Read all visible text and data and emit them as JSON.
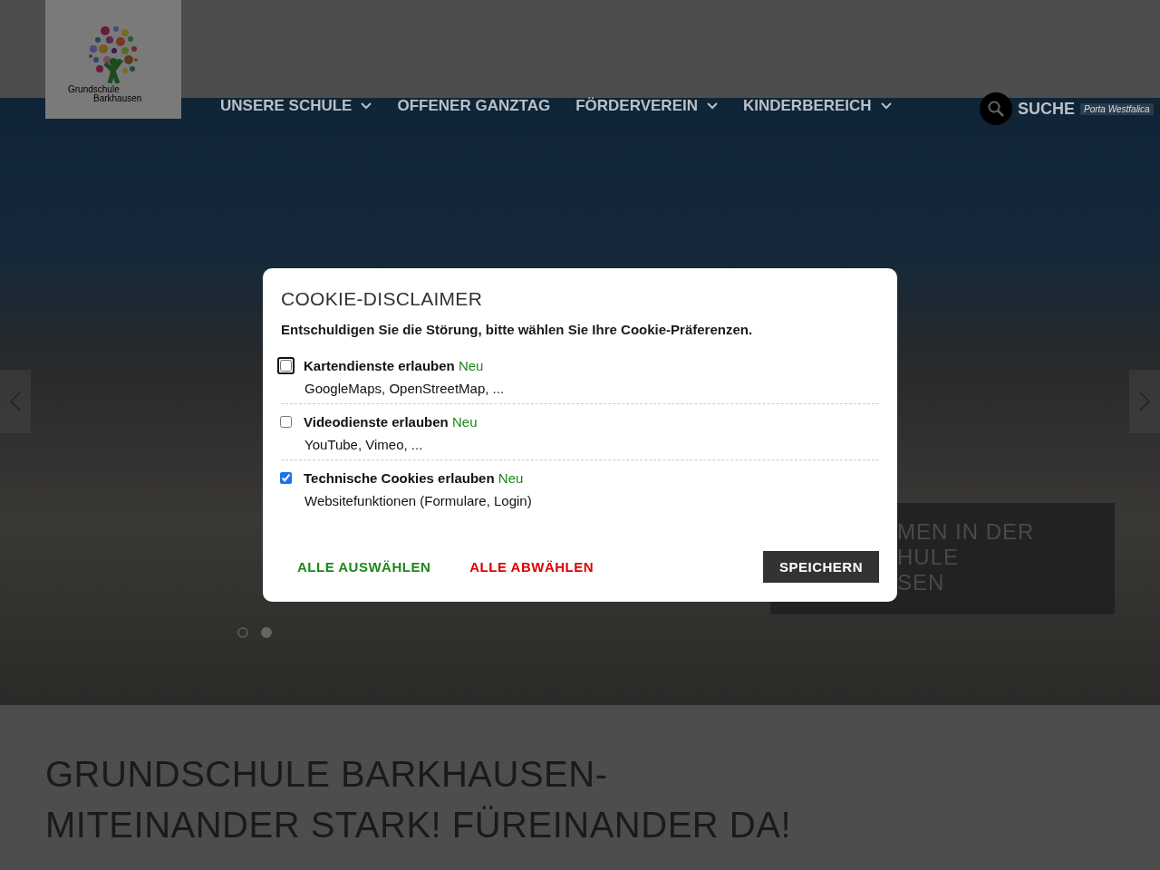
{
  "logo": {
    "lines": [
      "Grundschule",
      "Barkhausen"
    ]
  },
  "nav": [
    {
      "label": "UNSERE SCHULE",
      "dropdown": true
    },
    {
      "label": "OFFENER GANZTAG",
      "dropdown": false
    },
    {
      "label": "FÖRDERVEREIN",
      "dropdown": true
    },
    {
      "label": "KINDERBEREICH",
      "dropdown": true
    }
  ],
  "search": {
    "label": "SUCHE",
    "note": "Porta Westfalica"
  },
  "slider": {
    "caption_lines": [
      "MEN IN DER",
      "HULE",
      "SEN"
    ],
    "dots": [
      {
        "selected": false
      },
      {
        "selected": true
      }
    ]
  },
  "heading": {
    "lines": [
      "GRUNDSCHULE BARKHAUSEN-",
      "MITEINANDER STARK! FÜREINANDER DA!"
    ]
  },
  "cookie_dialog": {
    "title": "COOKIE-DISCLAIMER",
    "intro": "Entschuldigen Sie die Störung, bitte wählen Sie Ihre Cookie-Präferenzen.",
    "options": [
      {
        "label": "Kartendienste erlauben",
        "badge": "Neu",
        "description": "GoogleMaps, OpenStreetMap, ...",
        "checked": false,
        "focused": true
      },
      {
        "label": "Videodienste erlauben",
        "badge": "Neu",
        "description": "YouTube, Vimeo, ...",
        "checked": false,
        "focused": false
      },
      {
        "label": "Technische Cookies erlauben",
        "badge": "Neu",
        "description": "Websitefunktionen (Formulare, Login)",
        "checked": true,
        "focused": false
      }
    ],
    "buttons": [
      {
        "label": "ALLE AUSWÄHLEN",
        "kind": "accept"
      },
      {
        "label": "ALLE ABWÄHLEN",
        "kind": "reject"
      },
      {
        "label": "SPEICHERN",
        "kind": "save"
      }
    ]
  }
}
